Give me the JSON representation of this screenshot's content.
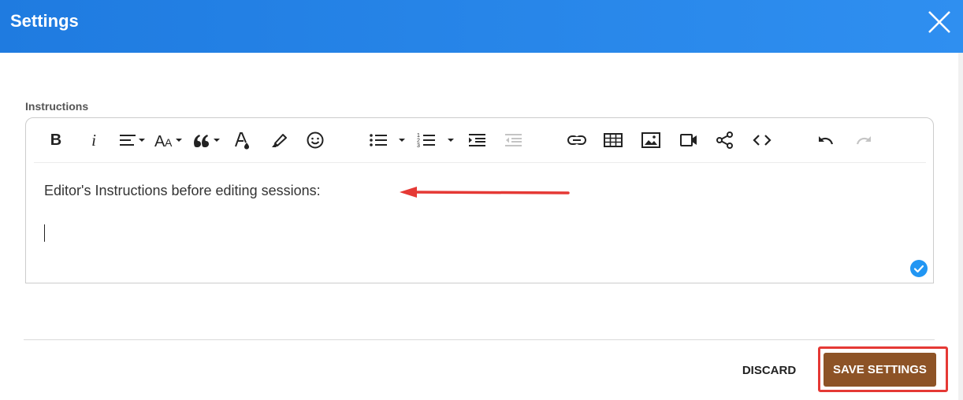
{
  "dialog": {
    "title": "Settings"
  },
  "field": {
    "label": "Instructions"
  },
  "editor": {
    "content_text": "Editor's Instructions before editing sessions:",
    "toolbar": {
      "bold": "B",
      "italic": "i"
    }
  },
  "footer": {
    "discard_label": "DISCARD",
    "save_label": "SAVE SETTINGS"
  },
  "colors": {
    "header": "#2a88eb",
    "save_button": "#8d5326",
    "highlight": "#e53935",
    "badge": "#2196f3"
  }
}
